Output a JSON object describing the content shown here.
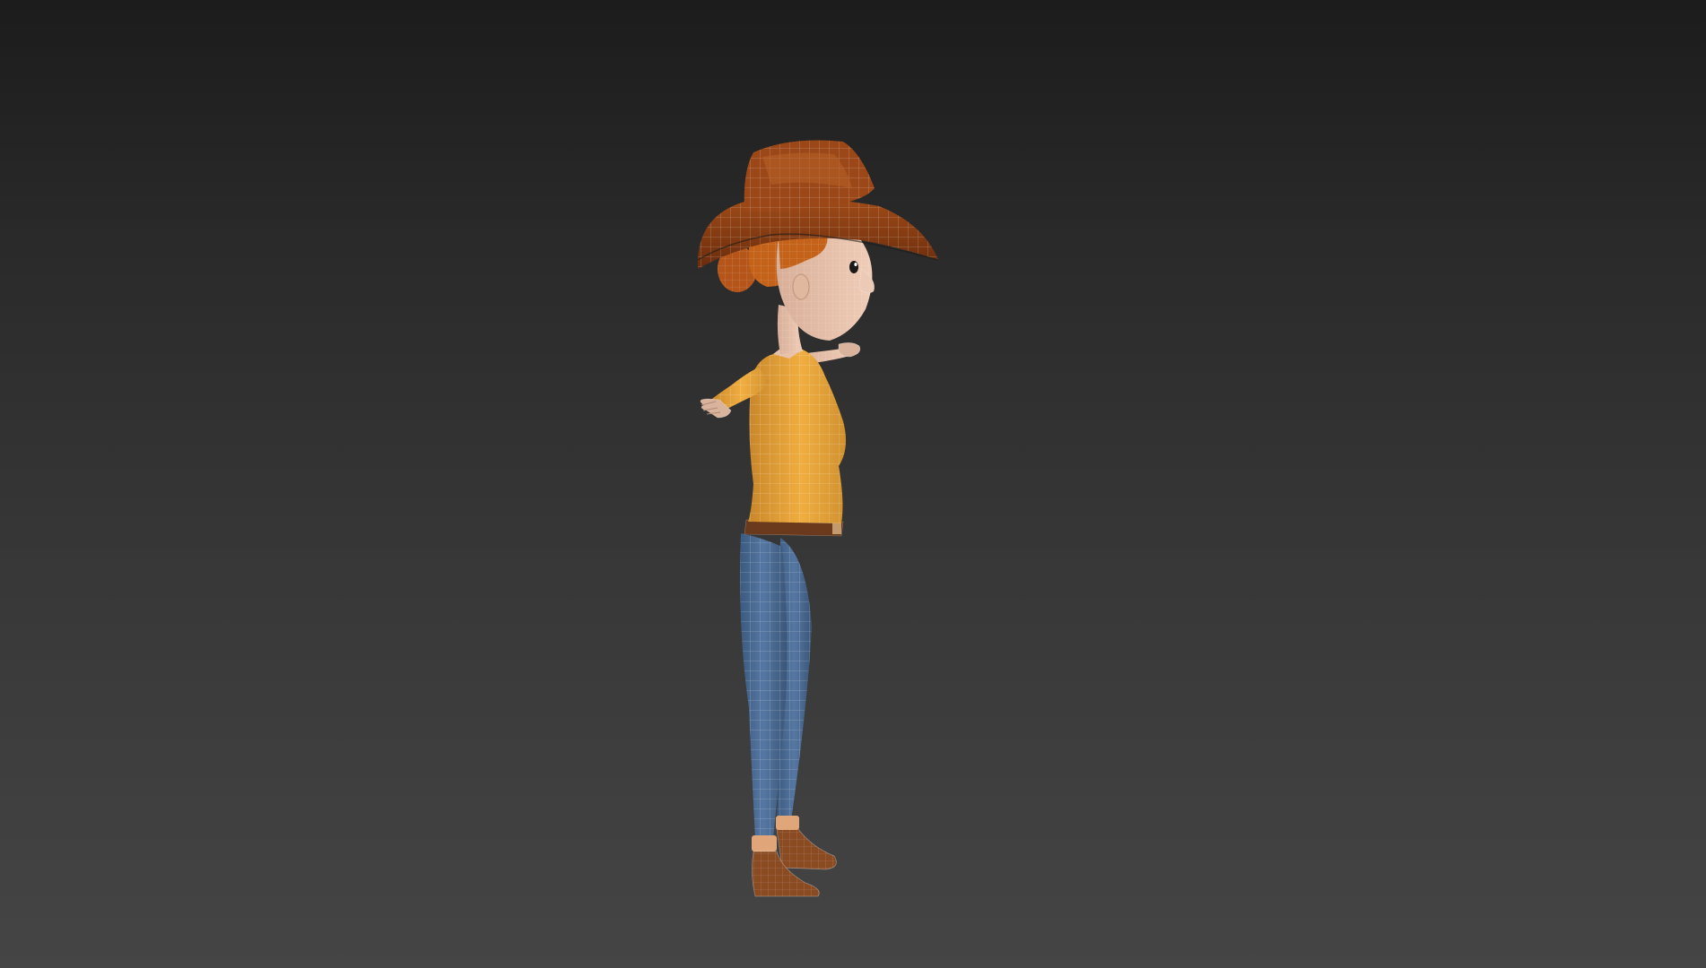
{
  "viewport": {
    "background_top": "#1c1c1c",
    "background_bottom": "#454545"
  },
  "model": {
    "subject": "cowgirl-character-wireframe",
    "display_mode": "shaded-with-wireframe",
    "colors": {
      "hat": "#8a3d10",
      "hair": "#c5621a",
      "skin": "#e8c2ac",
      "shirt": "#e8a435",
      "belt": "#6b3a1c",
      "jeans": "#4a6b94",
      "boots": "#8a4a22",
      "wire": "#ffffff"
    }
  }
}
